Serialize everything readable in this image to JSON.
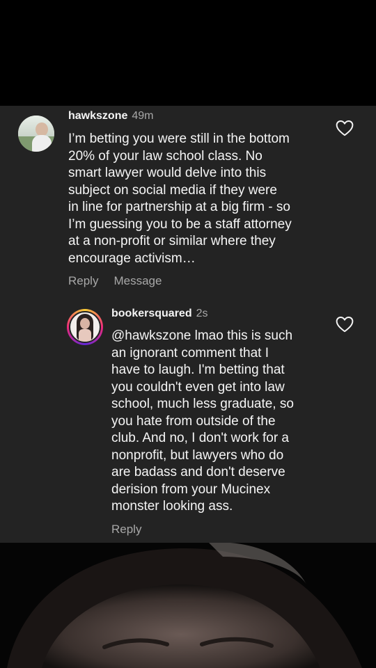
{
  "comments": [
    {
      "username": "hawkszone",
      "time": "49m",
      "avatar_icon": "profile-photo-man-outdoors",
      "text_lines": [
        "I’m betting you were still in the bottom",
        "20% of your law school class.  No",
        "smart lawyer would delve into this",
        "subject on social media if they were",
        "in line for partnership at a big firm - so",
        "I’m guessing you to be a staff attorney",
        "at a non-profit or similar where they",
        "encourage activism…"
      ],
      "actions": [
        "Reply",
        "Message"
      ],
      "like_icon": "heart-icon"
    },
    {
      "username": "bookersquared",
      "time": "2s",
      "avatar_icon": "profile-photo-woman-story-ring",
      "text_lines": [
        "@hawkszone lmao this is such",
        "an ignorant comment that I",
        "have to laugh. I'm betting that",
        "you couldn't even get into law",
        "school, much less graduate, so",
        "you hate from outside of the",
        "club. And no, I don't work for a",
        "nonprofit, but lawyers who do",
        "are badass and don't deserve",
        "derision from your Mucinex",
        "monster looking ass."
      ],
      "actions": [
        "Reply"
      ],
      "like_icon": "heart-icon"
    }
  ],
  "colors": {
    "panel_bg": "#232323",
    "text_primary": "#f5f5f5",
    "text_secondary": "#a8a8a8",
    "outer_bg": "#000000"
  }
}
